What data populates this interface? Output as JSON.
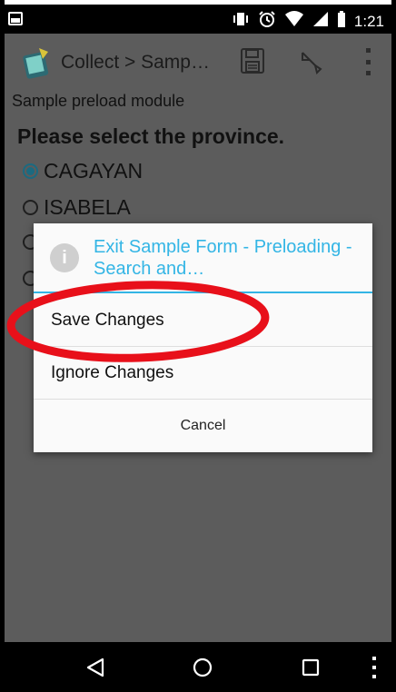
{
  "status_bar": {
    "time": "1:21",
    "icons": [
      "image-notification-icon",
      "vibrate-icon",
      "alarm-icon",
      "wifi-icon",
      "signal-icon",
      "battery-icon"
    ]
  },
  "action_bar": {
    "title": "Collect > Samp…",
    "icons": [
      "app-icon",
      "save-icon",
      "navigate-icon",
      "more-vert-icon"
    ]
  },
  "form": {
    "name": "Sample preload module",
    "question": "Please select the province.",
    "options": [
      {
        "label": "CAGAYAN",
        "selected": true
      },
      {
        "label": "ISABELA",
        "selected": false
      },
      {
        "label": "",
        "selected": false
      },
      {
        "label": "",
        "selected": false
      }
    ]
  },
  "dialog": {
    "title": "Exit Sample Form - Preloading - Search and…",
    "items": [
      "Save Changes",
      "Ignore Changes"
    ],
    "cancel": "Cancel",
    "accent_color": "#33b5e5"
  },
  "annotation": {
    "color": "#e8101a",
    "shape": "ellipse"
  },
  "nav_bar": {
    "buttons": [
      "back-icon",
      "home-icon",
      "recents-icon",
      "more-vert-icon"
    ]
  }
}
